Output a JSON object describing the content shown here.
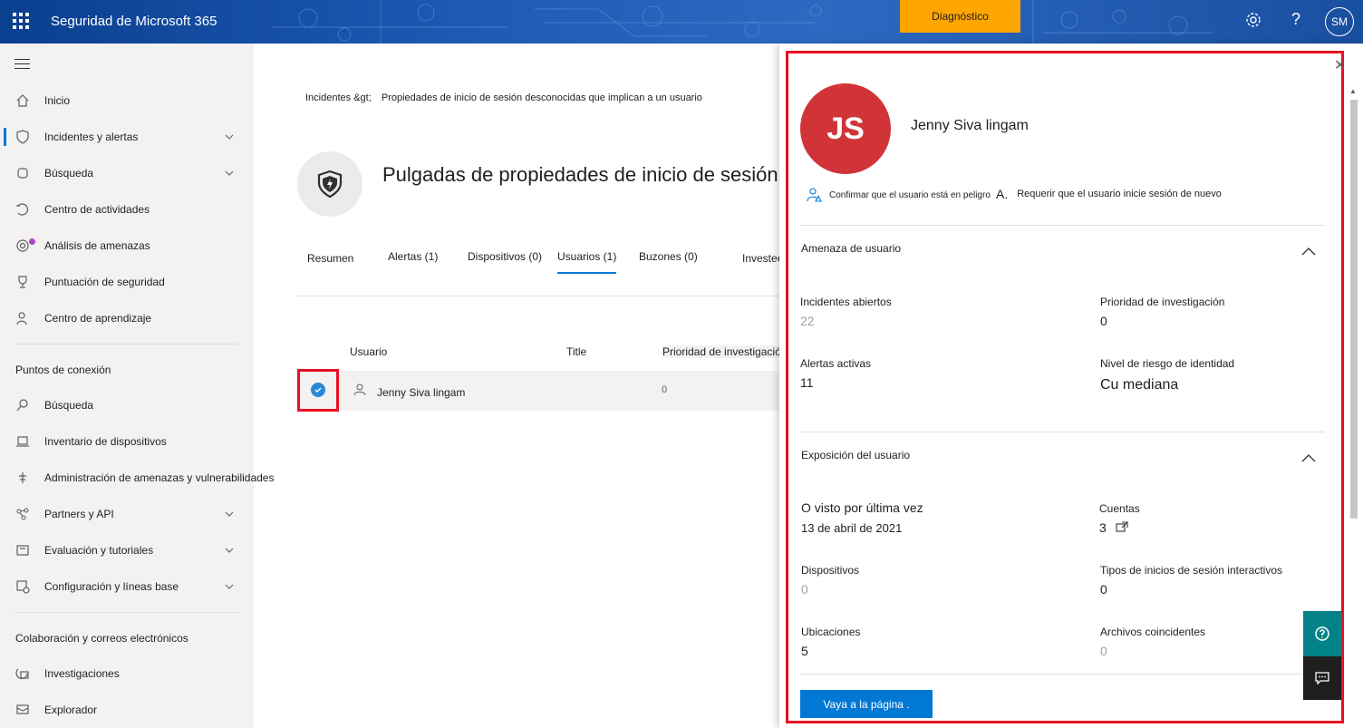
{
  "app": {
    "title": "Seguridad de Microsoft 365",
    "diagnostics_label": "Diagnóstico",
    "help_glyph": "?",
    "avatar_initials": "SM"
  },
  "sidebar": {
    "items": [
      {
        "label": "Inicio",
        "icon": "home-icon"
      },
      {
        "label": "Incidentes y alertas",
        "icon": "shield-icon"
      },
      {
        "label": "Búsqueda",
        "icon": "hunting-icon"
      },
      {
        "label": "Centro de actividades",
        "icon": "action-center-icon"
      },
      {
        "label": "Análisis de amenazas",
        "icon": "threat-analytics-icon"
      },
      {
        "label": "Puntuación de seguridad",
        "icon": "trophy-icon"
      },
      {
        "label": "Centro de aprendizaje",
        "icon": "learning-icon"
      }
    ],
    "endpoints_title": "Puntos de conexión",
    "endpoints": [
      {
        "label": "Búsqueda",
        "icon": "search-icon"
      },
      {
        "label": "Inventario de dispositivos",
        "icon": "laptop-icon"
      },
      {
        "label": "Administración de amenazas y vulnerabilidades",
        "icon": "tvm-icon"
      },
      {
        "label": "Partners y API",
        "icon": "partners-icon"
      },
      {
        "label": "Evaluación y tutoriales",
        "icon": "evaluation-icon"
      },
      {
        "label": "Configuración y líneas base",
        "icon": "config-icon"
      }
    ],
    "collab_title": "Colaboración y correos electrónicos",
    "collab": [
      {
        "label": "Investigaciones",
        "icon": "investigations-icon"
      },
      {
        "label": "Explorador",
        "icon": "explorer-icon"
      }
    ]
  },
  "main": {
    "breadcrumb_root": "Incidentes &gt;",
    "breadcrumb_current": "Propiedades de inicio de sesión desconocidas que implican a un usuario",
    "incident_title": "Pulgadas de propiedades de inicio de sesión desconocidas",
    "tabs": [
      "Resumen",
      "Alertas (1)",
      "Dispositivos (0)",
      "Usuarios (1)",
      "Buzones (0)",
      "Investee"
    ],
    "columns": [
      "Usuario",
      "Title",
      "Prioridad de investigación"
    ],
    "row": {
      "user": "Jenny Siva lingam",
      "priority": "0"
    }
  },
  "panel": {
    "initials": "JS",
    "user_name": "Jenny Siva lingam",
    "action_compromised": "Confirmar que el usuario está en peligro",
    "action_resignin_glyph": "A.",
    "action_resignin": "Requerir que el usuario inicie sesión de nuevo",
    "threat_section": "Amenaza de usuario",
    "open_incidents_label": "Incidentes abiertos",
    "open_incidents": "22",
    "inv_priority_label": "Prioridad de investigación",
    "inv_priority": "0",
    "active_alerts_label": "Alertas activas",
    "active_alerts": "11",
    "identity_risk_label": "Nivel de riesgo de identidad",
    "identity_risk": "Cu mediana",
    "exposure_section": "Exposición del usuario",
    "last_seen_label": "O visto por última vez",
    "last_seen": "13 de abril de 2021",
    "accounts_label": "Cuentas",
    "accounts": "3",
    "devices_label": "Dispositivos",
    "devices": "0",
    "interactive_label": "Tipos de inicios de sesión interactivos",
    "interactive": "0",
    "locations_label": "Ubicaciones",
    "locations": "5",
    "files_label": "Archivos coincidentes",
    "files": "0",
    "go_button": "Vaya a la página ."
  },
  "colors": {
    "accent": "#0078d4",
    "highlight": "#e81123",
    "avatar": "#d13438",
    "diagnostics": "#ffa500"
  }
}
